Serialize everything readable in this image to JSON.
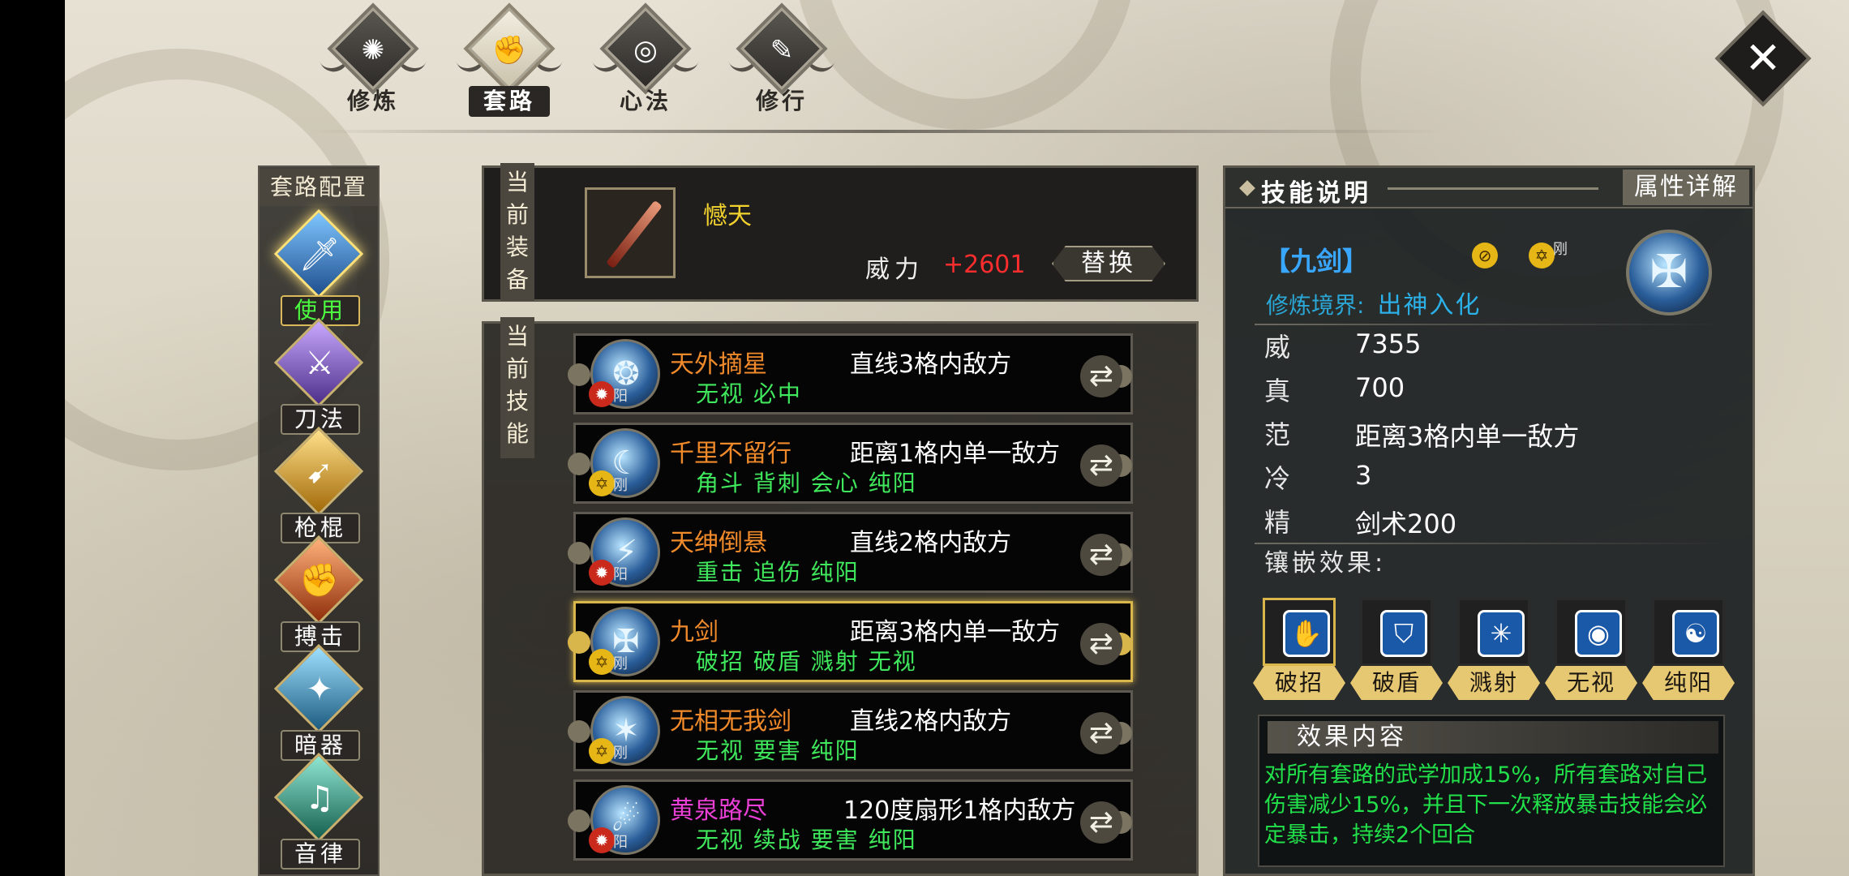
{
  "tabs": [
    {
      "label": "修炼",
      "icon": "spiral-icon",
      "active": false
    },
    {
      "label": "套路",
      "icon": "fist-icon",
      "active": true
    },
    {
      "label": "心法",
      "icon": "swirl-icon",
      "active": false
    },
    {
      "label": "修行",
      "icon": "scroll-icon",
      "active": false
    }
  ],
  "close": {
    "glyph": "✕"
  },
  "categories": {
    "title": "套路配置",
    "items": [
      {
        "label": "使用中",
        "icon": "sword-icon",
        "color": "#2f6fb8",
        "active": true
      },
      {
        "label": "刀法",
        "icon": "blade-icon",
        "color": "#7a58b8",
        "active": false
      },
      {
        "label": "枪棍",
        "icon": "spear-icon",
        "color": "#d9a126",
        "active": false
      },
      {
        "label": "搏击",
        "icon": "fist-icon",
        "color": "#c8501c",
        "active": false
      },
      {
        "label": "暗器",
        "icon": "dart-icon",
        "color": "#2e7fa8",
        "active": false
      },
      {
        "label": "音律",
        "icon": "lute-icon",
        "color": "#2b8a78",
        "active": false
      }
    ]
  },
  "equipment": {
    "label": "当前装备",
    "name": "憾天",
    "power_label": "威力",
    "power_value": "+2601",
    "replace_label": "替换"
  },
  "skills_panel": {
    "label": "当前技能",
    "items": [
      {
        "name": "天外摘星",
        "range": "直线3格内敌方",
        "effects": "无视 必中",
        "badge": "red",
        "tag": "阳",
        "selected": false
      },
      {
        "name": "千里不留行",
        "range": "距离1格内单一敌方",
        "effects": "角斗 背刺 会心 纯阳",
        "badge": "gold",
        "tag": "刚",
        "selected": false
      },
      {
        "name": "天绅倒悬",
        "range": "直线2格内敌方",
        "effects": "重击 追伤 纯阳",
        "badge": "red",
        "tag": "阳",
        "selected": false
      },
      {
        "name": "九剑",
        "range": "距离3格内单一敌方",
        "effects": "破招 破盾 溅射 无视",
        "badge": "gold",
        "tag": "刚",
        "selected": true
      },
      {
        "name": "无相无我剑",
        "range": "直线2格内敌方",
        "effects": "无视 要害 纯阳",
        "badge": "gold",
        "tag": "刚",
        "selected": false
      },
      {
        "name": "黄泉路尽",
        "range": "120度扇形1格内敌方",
        "effects": "无视 续战 要害 纯阳",
        "badge": "red",
        "tag": "阳",
        "selected": false
      }
    ]
  },
  "description": {
    "title": "技能说明",
    "attr_button": "属性详解",
    "skill_name": "【九剑】",
    "badge_tag": "刚",
    "realm_label": "修炼境界:",
    "realm_value": "出神入化",
    "stats": [
      {
        "key": "威",
        "value": "7355"
      },
      {
        "key": "真",
        "value": "700"
      },
      {
        "key": "范",
        "value": "距离3格内单一敌方"
      },
      {
        "key": "冷",
        "value": "3"
      },
      {
        "key": "精",
        "value": "剑术200"
      }
    ],
    "inlay_title": "镶嵌效果:",
    "gems": [
      {
        "label": "破招",
        "icon": "claw-icon",
        "active": true
      },
      {
        "label": "破盾",
        "icon": "shield-icon",
        "active": false
      },
      {
        "label": "溅射",
        "icon": "burst-icon",
        "active": false
      },
      {
        "label": "无视",
        "icon": "eye-icon",
        "active": false
      },
      {
        "label": "纯阳",
        "icon": "yinyang-icon",
        "active": false
      }
    ],
    "effect_title": "效果内容",
    "effect_text": "对所有套路的武学加成15%，所有套路对自己伤害减少15%，并且下一次释放暴击技能会必定暴击，持续2个回合"
  }
}
